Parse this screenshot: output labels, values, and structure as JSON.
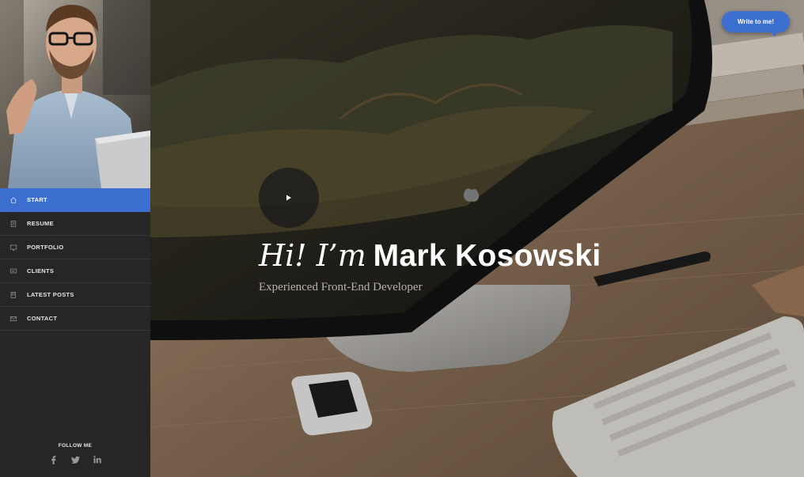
{
  "sidebar": {
    "nav": [
      {
        "label": "Start",
        "icon": "home-icon",
        "active": true
      },
      {
        "label": "Resume",
        "icon": "document-icon",
        "active": false
      },
      {
        "label": "Portfolio",
        "icon": "monitor-icon",
        "active": false
      },
      {
        "label": "Clients",
        "icon": "chat-icon",
        "active": false
      },
      {
        "label": "Latest Posts",
        "icon": "book-icon",
        "active": false
      },
      {
        "label": "Contact",
        "icon": "envelope-icon",
        "active": false
      }
    ],
    "follow_title": "Follow Me",
    "social": [
      {
        "name": "facebook",
        "glyph": "f"
      },
      {
        "name": "twitter",
        "glyph": "t"
      },
      {
        "name": "linkedin",
        "glyph": "in"
      }
    ]
  },
  "hero": {
    "greeting": "Hi! I’m",
    "name": "Mark Kosowski",
    "subtitle": "Experienced Front-End Developer"
  },
  "cta": {
    "write_label": "Write to me!"
  },
  "colors": {
    "accent": "#3d6fd1",
    "sidebar_bg": "#262626"
  }
}
